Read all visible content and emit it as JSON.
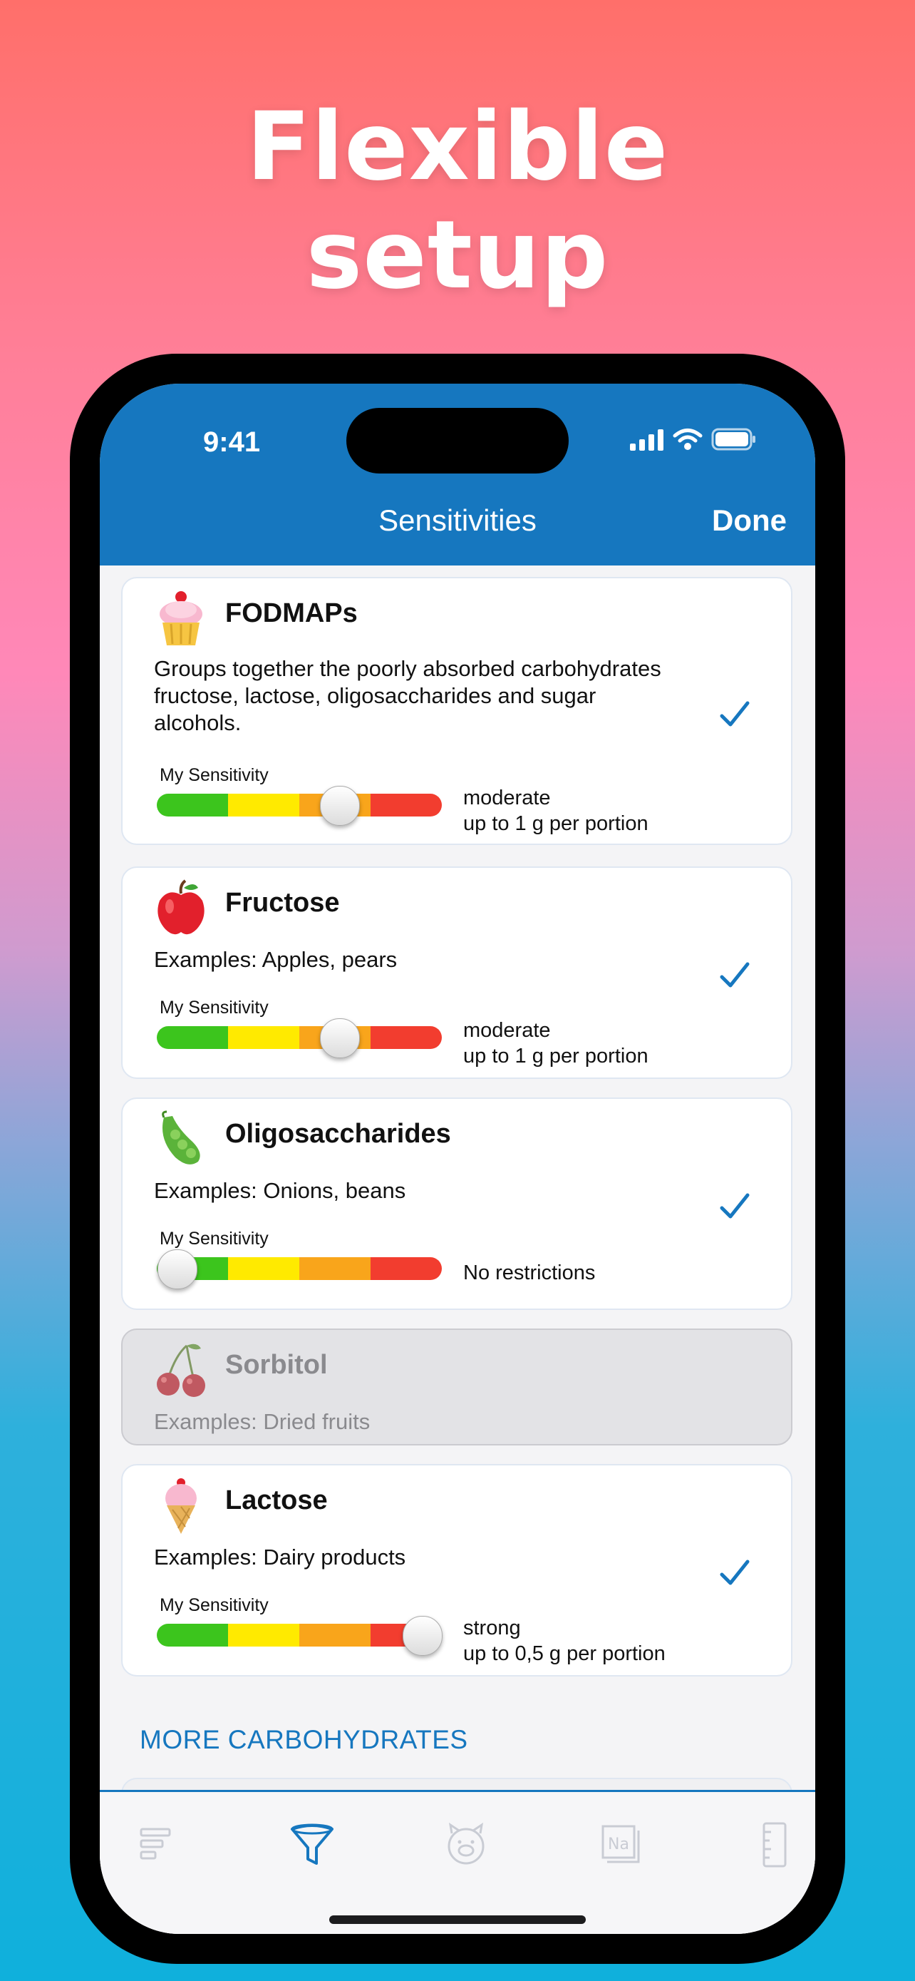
{
  "headline": {
    "line1": "Flexible",
    "line2": "setup"
  },
  "status": {
    "time": "9:41"
  },
  "nav": {
    "title": "Sensitivities",
    "done_label": "Done"
  },
  "sensitivity_label": "My Sensitivity",
  "cards": [
    {
      "title": "FODMAPs",
      "icon": "cupcake-icon",
      "desc_lines": [
        "Groups together the poorly absorbed carbohydrates",
        "fructose, lactose, oligosaccharides and sugar",
        "alcohols."
      ],
      "selected": true,
      "level": "moderate",
      "limit": "up to 1 g per portion",
      "slider_value": 0.64
    },
    {
      "title": "Fructose",
      "icon": "apple-icon",
      "desc": "Examples: Apples, pears",
      "selected": true,
      "level": "moderate",
      "limit": "up to 1 g per portion",
      "slider_value": 0.64
    },
    {
      "title": "Oligosaccharides",
      "icon": "peas-icon",
      "desc": "Examples: Onions, beans",
      "selected": true,
      "level": "No restrictions",
      "slider_value": 0.07
    },
    {
      "title": "Sorbitol",
      "icon": "cherries-icon",
      "desc": "Examples: Dried fruits",
      "selected": false,
      "disabled": true
    },
    {
      "title": "Lactose",
      "icon": "ice-cream-icon",
      "desc": "Examples: Dairy products",
      "selected": true,
      "level": "strong",
      "limit": "up to 0,5 g per portion",
      "slider_value": 0.93
    }
  ],
  "section": {
    "more_carbs": "MORE CARBOHYDRATES"
  },
  "colors": {
    "brand": "#1677bf",
    "green": "#3cc51d",
    "yellow": "#ffea00",
    "orange": "#f9a51b",
    "red": "#f23d2f"
  },
  "tabbar": {
    "items": [
      "list-icon",
      "funnel-icon",
      "piggy-icon",
      "sodium-icon",
      "ruler-icon"
    ],
    "active": 1
  }
}
